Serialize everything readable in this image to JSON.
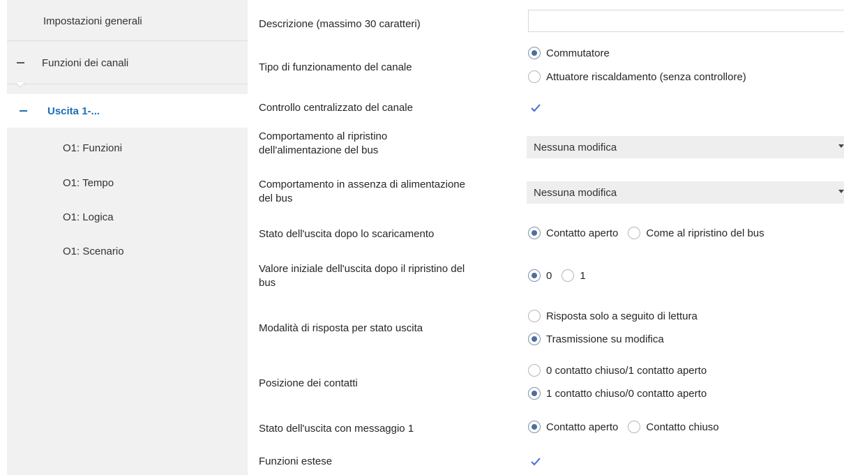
{
  "sidebar": {
    "general": "Impostazioni generali",
    "channel_functions": "Funzioni dei canali",
    "output": "Uscita 1-...",
    "sub": [
      "O1: Funzioni",
      "O1: Tempo",
      "O1: Logica",
      "O1: Scenario"
    ]
  },
  "params": {
    "description": {
      "label": "Descrizione (massimo 30 caratteri)",
      "value": ""
    },
    "channel_type": {
      "label": "Tipo di funzionamento del canale",
      "options": [
        "Commutatore",
        "Attuatore riscaldamento (senza controllore)"
      ],
      "selected": 0
    },
    "central_control": {
      "label": "Controllo centralizzato del canale",
      "checked": true
    },
    "bus_restore": {
      "label_line1": "Comportamento al ripristino",
      "label_line2": "dell'alimentazione del bus",
      "value": "Nessuna modifica"
    },
    "bus_loss": {
      "label_line1": "Comportamento in assenza di alimentazione",
      "label_line2": "del bus",
      "value": "Nessuna modifica"
    },
    "after_download": {
      "label": "Stato dell'uscita dopo lo scaricamento",
      "options": [
        "Contatto aperto",
        "Come al ripristino del bus"
      ],
      "selected": 0
    },
    "initial_value": {
      "label_line1": "Valore iniziale dell'uscita dopo il ripristino del",
      "label_line2": "bus",
      "options": [
        "0",
        "1"
      ],
      "selected": 0
    },
    "response_mode": {
      "label": "Modalità di risposta per stato uscita",
      "options": [
        "Risposta solo a seguito di lettura",
        "Trasmissione su modifica"
      ],
      "selected": 1
    },
    "contact_position": {
      "label": "Posizione dei contatti",
      "options": [
        "0 contatto chiuso/1 contatto aperto",
        "1 contatto chiuso/0 contatto aperto"
      ],
      "selected": 1
    },
    "message1_state": {
      "label": "Stato dell'uscita con messaggio 1",
      "options": [
        "Contatto aperto",
        "Contatto chiuso"
      ],
      "selected": 0
    },
    "extended_functions": {
      "label": "Funzioni estese",
      "checked": true
    }
  },
  "colors": {
    "accent": "#1b6fb8",
    "sidebar_bg": "#f1f1f1",
    "radio_dot": "#4e6f9a",
    "check": "#3b6fd6"
  }
}
